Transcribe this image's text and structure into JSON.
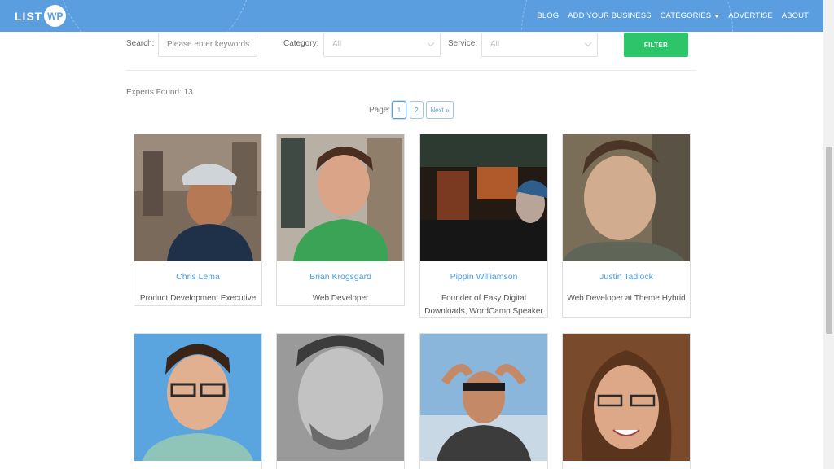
{
  "header": {
    "logo_text": "LIST",
    "logo_badge": "WP",
    "nav": [
      "BLOG",
      "ADD YOUR BUSINESS",
      "CATEGORIES",
      "ADVERTISE",
      "ABOUT"
    ],
    "brand_color": "#5b9ee0"
  },
  "filters": {
    "search_label": "Search:",
    "search_placeholder": "Please enter keywords",
    "category_label": "Category:",
    "category_value": "All",
    "service_label": "Service:",
    "service_value": "All",
    "filter_button": "FILTER",
    "button_color": "#2ec46a"
  },
  "results": {
    "found_text": "Experts Found: 13",
    "page_label": "Page:",
    "pages": [
      "1",
      "2",
      "Next »"
    ],
    "current_page": "1"
  },
  "experts": [
    {
      "name": "Chris Lema",
      "role": "Product Development Executive"
    },
    {
      "name": "Brian Krogsgard",
      "role": "Web Developer"
    },
    {
      "name": "Pippin Williamson",
      "role": "Founder of Easy Digital Downloads, WordCamp Speaker"
    },
    {
      "name": "Justin Tadlock",
      "role": "Web Developer at Theme Hybrid"
    },
    {
      "name": "",
      "role": ""
    },
    {
      "name": "",
      "role": ""
    },
    {
      "name": "",
      "role": ""
    },
    {
      "name": "",
      "role": ""
    }
  ]
}
